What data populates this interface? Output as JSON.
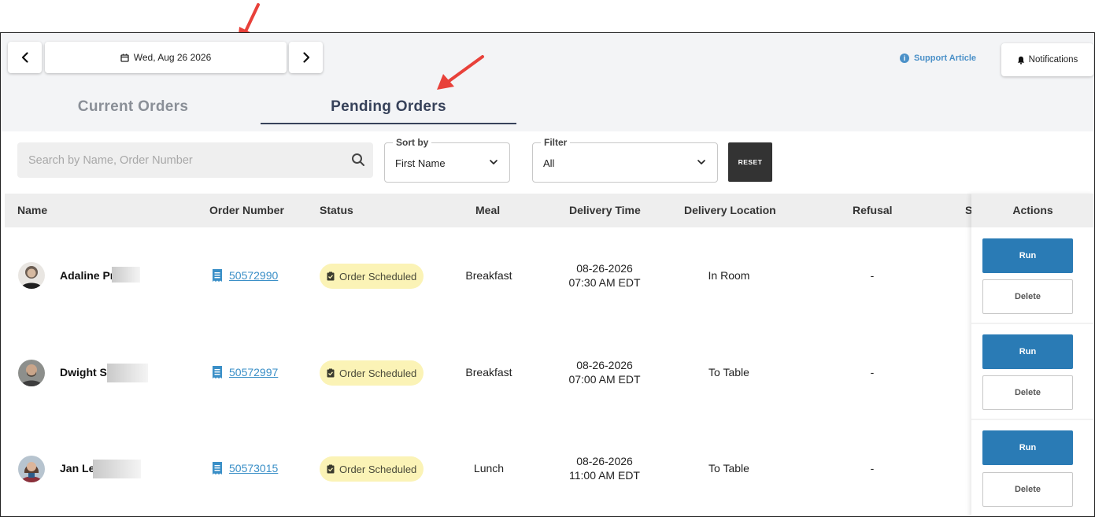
{
  "header": {
    "date_label": "Wed, Aug 26 2026",
    "support_label": "Support Article",
    "notifications_label": "Notifications"
  },
  "tabs": [
    {
      "label": "Current Orders",
      "active": false
    },
    {
      "label": "Pending Orders",
      "active": true
    }
  ],
  "filters": {
    "search_placeholder": "Search by Name, Order Number",
    "sort_label": "Sort by",
    "sort_value": "First Name",
    "filter_label": "Filter",
    "filter_value": "All",
    "reset_label": "RESET"
  },
  "table": {
    "columns": [
      "Name",
      "Order Number",
      "Status",
      "Meal",
      "Delivery Time",
      "Delivery Location",
      "Refusal",
      "S"
    ],
    "actions_header": "Actions",
    "rows": [
      {
        "name": "Adaline Pr",
        "order_number": "50572990",
        "status": "Order Scheduled",
        "meal": "Breakfast",
        "delivery_date": "08-26-2026",
        "delivery_time": "07:30 AM EDT",
        "location": "In Room",
        "refusal": "-"
      },
      {
        "name": "Dwight S",
        "order_number": "50572997",
        "status": "Order Scheduled",
        "meal": "Breakfast",
        "delivery_date": "08-26-2026",
        "delivery_time": "07:00 AM EDT",
        "location": "To Table",
        "refusal": "-"
      },
      {
        "name": "Jan Le",
        "order_number": "50573015",
        "status": "Order Scheduled",
        "meal": "Lunch",
        "delivery_date": "08-26-2026",
        "delivery_time": "11:00 AM EDT",
        "location": "To Table",
        "refusal": "-"
      }
    ],
    "run_label": "Run",
    "delete_label": "Delete"
  },
  "colors": {
    "accent_blue": "#2a7bb5",
    "link_blue": "#3a8fc7",
    "status_bg": "#fbf3b6",
    "tab_active": "#37425a",
    "annotation_arrow": "#e8413a"
  }
}
